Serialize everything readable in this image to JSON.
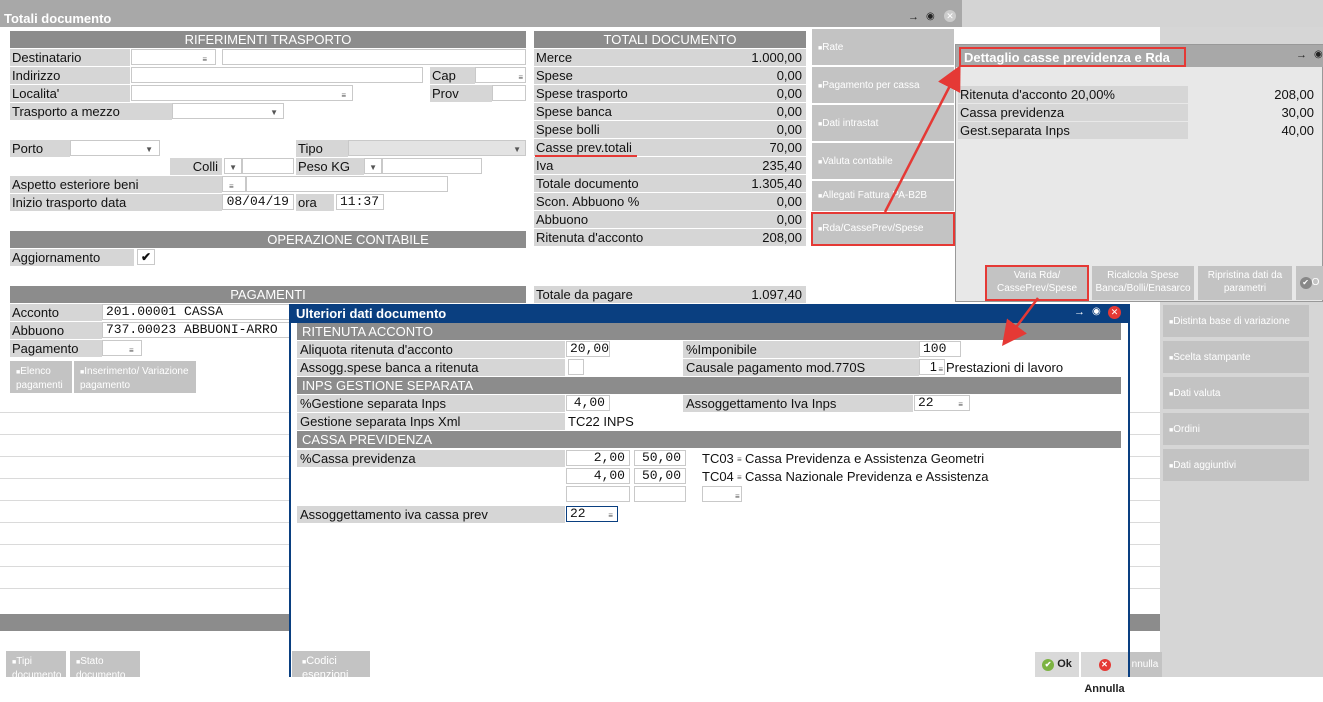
{
  "window": {
    "title": "Totali documento"
  },
  "riferimenti": {
    "header": "RIFERIMENTI TRASPORTO",
    "destinatario": "Destinatario",
    "indirizzo": "Indirizzo",
    "cap": "Cap",
    "localita": "Localita'",
    "prov": "Prov",
    "trasporto_mezzo": "Trasporto a mezzo",
    "porto": "Porto",
    "tipo": "Tipo",
    "colli": "Colli",
    "peso": "Peso KG",
    "aspetto": "Aspetto esteriore beni",
    "inizio": "Inizio trasporto  data",
    "data_value": "08/04/19",
    "ora": "ora",
    "ora_value": "11:37"
  },
  "operazione": {
    "header": "OPERAZIONE CONTABILE",
    "aggiornamento": "Aggiornamento",
    "check": "✔"
  },
  "pagamenti": {
    "header": "PAGAMENTI",
    "acconto": "Acconto",
    "acconto_value": "201.00001 CASSA",
    "abbuono": "Abbuono",
    "abbuono_value": "737.00023 ABBUONI-ARRO",
    "pagamento": "Pagamento",
    "btn_elenco": "Elenco pagamenti",
    "btn_inserimento": "Inserimento/ Variazione pagamento"
  },
  "totali": {
    "header": "TOTALI DOCUMENTO",
    "rows": [
      {
        "label": "Merce",
        "value": "1.000,00"
      },
      {
        "label": "Spese",
        "value": "0,00"
      },
      {
        "label": "Spese trasporto",
        "value": "0,00"
      },
      {
        "label": "Spese banca",
        "value": "0,00"
      },
      {
        "label": "Spese bolli",
        "value": "0,00"
      },
      {
        "label": "Casse prev.totali",
        "value": "70,00"
      },
      {
        "label": "Iva",
        "value": "235,40"
      },
      {
        "label": "Totale documento",
        "value": "1.305,40"
      },
      {
        "label": "Scon. Abbuono   %",
        "value": "0,00"
      },
      {
        "label": "Abbuono",
        "value": "0,00"
      },
      {
        "label": "Ritenuta d'acconto",
        "value": "208,00"
      }
    ],
    "totale_pagare": "Totale da pagare",
    "totale_pagare_value": "1.097,40"
  },
  "side_buttons": [
    "Rate",
    "Pagamento per cassa",
    "Dati intrastat",
    "Valuta contabile",
    "Allegati Fattura PA-B2B",
    "Rda/CassePrev/Spese"
  ],
  "right_buttons": [
    "Distinta base di variazione",
    "Scelta stampante",
    "Dati valuta",
    "Ordini",
    "Dati aggiuntivi"
  ],
  "bottom_buttons": {
    "tipi": "Tipi documento",
    "stato": "Stato documento",
    "annulla_bg": "nnulla"
  },
  "dettaglio": {
    "title": "Dettaglio casse previdenza e Rda",
    "rows": [
      {
        "label": "Ritenuta d'acconto 20,00%",
        "value": "208,00"
      },
      {
        "label": "Cassa previdenza",
        "value": "30,00"
      },
      {
        "label": "Gest.separata Inps",
        "value": "40,00"
      }
    ],
    "btn_varia": "Varia Rda/ CassePrev/Spese",
    "btn_ricalcola": "Ricalcola Spese Banca/Bolli/Enasarco",
    "btn_ripristina": "Ripristina dati da parametri",
    "btn_ok_partial": "O"
  },
  "ulteriori": {
    "title": "Ulteriori dati documento",
    "sec_ritenuta": "RITENUTA ACCONTO",
    "aliquota_label": "Aliquota ritenuta d'acconto",
    "aliquota_value": "20,00",
    "imponibile_label": "%Imponibile",
    "imponibile_value": "100",
    "assogg_spese_label": "Assogg.spese banca a ritenuta",
    "causale_label": "Causale pagamento mod.770S",
    "causale_code": "1",
    "causale_desc": "Prestazioni di lavoro",
    "sec_inps": "INPS GESTIONE SEPARATA",
    "gest_sep_label": "%Gestione separata Inps",
    "gest_sep_value": "4,00",
    "assogg_iva_inps_label": "Assoggettamento Iva Inps",
    "assogg_iva_inps_value": "22",
    "gest_xml_label": "Gestione separata Inps Xml",
    "gest_xml_value": "TC22  INPS",
    "sec_cassa": "CASSA PREVIDENZA",
    "cassa_label": "%Cassa previdenza",
    "cassa_rows": [
      {
        "perc": "2,00",
        "imp": "50,00",
        "code": "TC03",
        "desc": "Cassa Previdenza e Assistenza Geometri"
      },
      {
        "perc": "4,00",
        "imp": "50,00",
        "code": "TC04",
        "desc": "Cassa Nazionale Previdenza e Assistenza"
      }
    ],
    "assogg_cassa_label": "Assoggettamento iva cassa prev",
    "assogg_cassa_value": "22",
    "btn_codici": "Codici esenzioni iva",
    "btn_ok": "Ok",
    "btn_annulla": "Annulla"
  },
  "colors": {
    "dialog_title": "#0a3f80",
    "highlight": "#e53935",
    "section": "#8c8c8c"
  }
}
